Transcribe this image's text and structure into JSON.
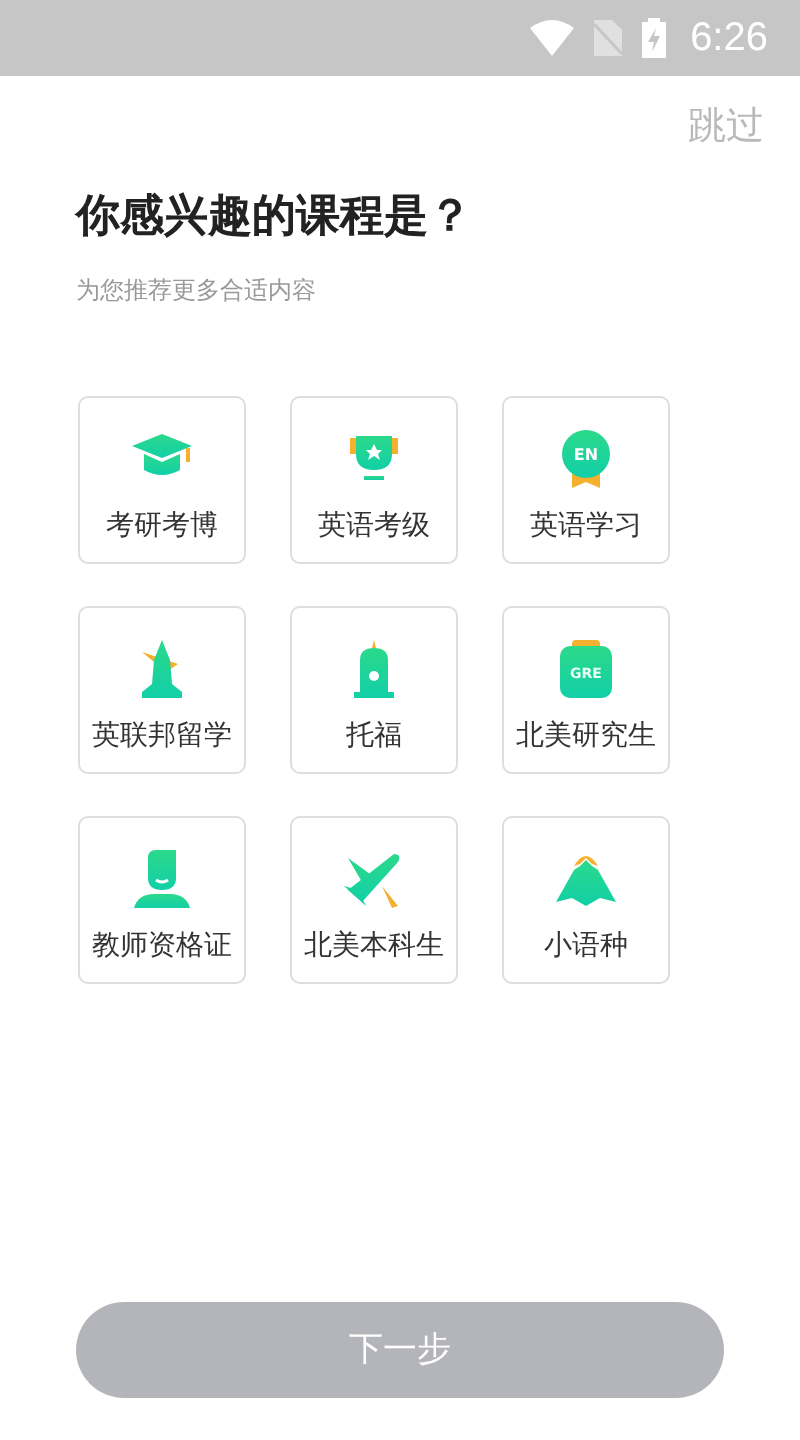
{
  "status_bar": {
    "time": "6:26"
  },
  "skip": "跳过",
  "title": "你感兴趣的课程是？",
  "subtitle": "为您推荐更多合适内容",
  "courses": [
    {
      "kind": "cap",
      "label": "考研考博",
      "selected": false
    },
    {
      "kind": "trophy",
      "label": "英语考级",
      "selected": false
    },
    {
      "kind": "medal",
      "icon_text": "EN",
      "label": "英语学习",
      "selected": false
    },
    {
      "kind": "tower",
      "label": "英联邦留学",
      "selected": false
    },
    {
      "kind": "building",
      "label": "托福",
      "selected": false
    },
    {
      "kind": "clipboard",
      "icon_text": "GRE",
      "label": "北美研究生",
      "selected": false
    },
    {
      "kind": "person",
      "label": "教师资格证",
      "selected": false
    },
    {
      "kind": "plane",
      "label": "北美本科生",
      "selected": false
    },
    {
      "kind": "mountain",
      "label": "小语种",
      "selected": false
    }
  ],
  "next_button": {
    "label": "下一步",
    "disabled": true
  }
}
